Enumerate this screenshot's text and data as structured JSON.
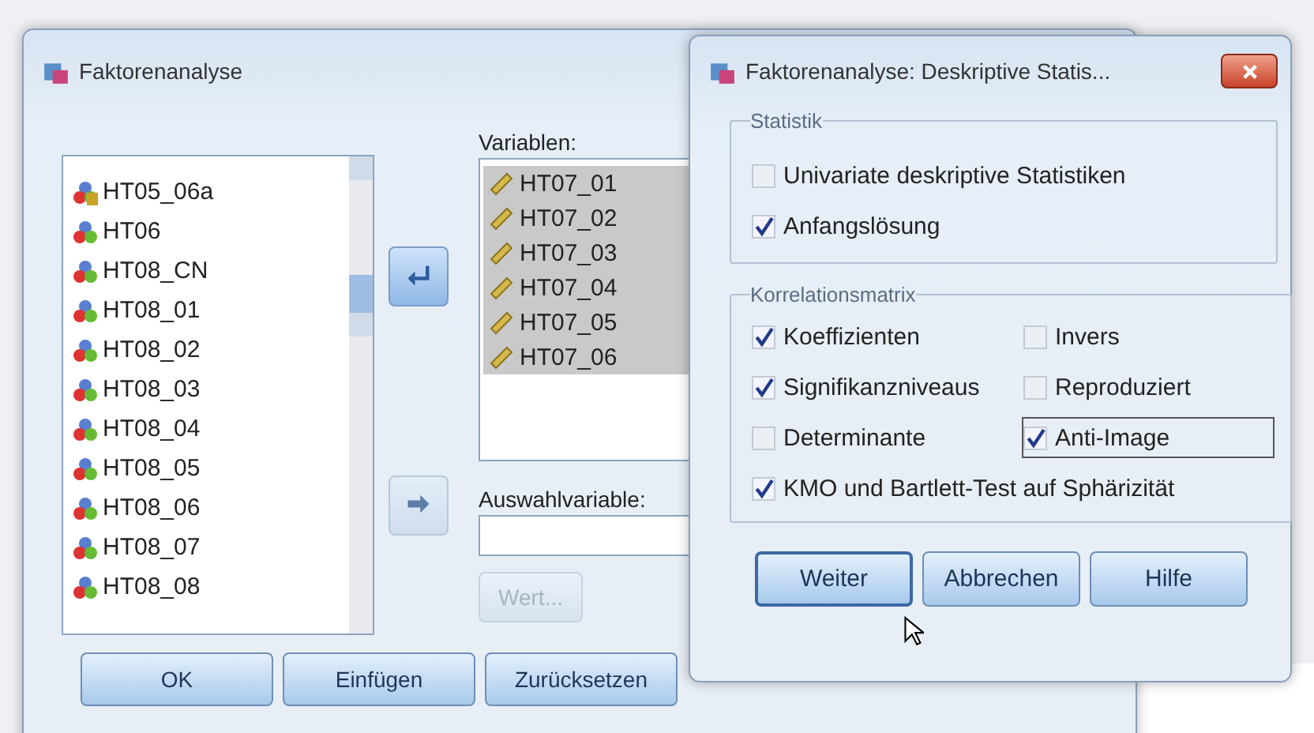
{
  "main_dialog": {
    "title": "Faktorenanalyse",
    "source_variables": [
      {
        "name": "HT05_06a",
        "kind": "string"
      },
      {
        "name": "HT06",
        "kind": "nominal"
      },
      {
        "name": "HT08_CN",
        "kind": "nominal"
      },
      {
        "name": "HT08_01",
        "kind": "nominal"
      },
      {
        "name": "HT08_02",
        "kind": "nominal"
      },
      {
        "name": "HT08_03",
        "kind": "nominal"
      },
      {
        "name": "HT08_04",
        "kind": "nominal"
      },
      {
        "name": "HT08_05",
        "kind": "nominal"
      },
      {
        "name": "HT08_06",
        "kind": "nominal"
      },
      {
        "name": "HT08_07",
        "kind": "nominal"
      },
      {
        "name": "HT08_08",
        "kind": "nominal"
      }
    ],
    "variables_label": "Variablen:",
    "variables": [
      {
        "name": "HT07_01",
        "kind": "scale",
        "selected": true
      },
      {
        "name": "HT07_02",
        "kind": "scale",
        "selected": true
      },
      {
        "name": "HT07_03",
        "kind": "scale",
        "selected": true
      },
      {
        "name": "HT07_04",
        "kind": "scale",
        "selected": true
      },
      {
        "name": "HT07_05",
        "kind": "scale",
        "selected": true
      },
      {
        "name": "HT07_06",
        "kind": "scale",
        "selected": true
      }
    ],
    "move_buttons": [
      {
        "disabled": false
      },
      {
        "disabled": true
      }
    ],
    "selection_label": "Auswahlvariable:",
    "value_button": {
      "label": "Wert...",
      "disabled": true
    },
    "buttons": [
      {
        "label": "OK"
      },
      {
        "label": "Einfügen"
      },
      {
        "label": "Zurücksetzen"
      }
    ]
  },
  "sub_dialog": {
    "title": "Faktorenanalyse: Deskriptive Statis...",
    "groups": [
      {
        "title": "Statistik",
        "items": [
          {
            "label": "Univariate deskriptive Statistiken",
            "checked": false,
            "focused": false
          },
          {
            "label": "Anfangslösung",
            "checked": true,
            "focused": false
          }
        ]
      },
      {
        "title": "Korrelationsmatrix",
        "items": [
          {
            "label": "Koeffizienten",
            "checked": true,
            "focused": false
          },
          {
            "label": "Invers",
            "checked": false,
            "focused": false
          },
          {
            "label": "Signifikanzniveaus",
            "checked": true,
            "focused": false
          },
          {
            "label": "Reproduziert",
            "checked": false,
            "focused": false
          },
          {
            "label": "Determinante",
            "checked": false,
            "focused": false
          },
          {
            "label": "Anti-Image",
            "checked": true,
            "focused": true
          },
          {
            "label": "KMO und Bartlett-Test auf Sphärizität",
            "checked": true,
            "focused": false
          }
        ]
      }
    ],
    "buttons": [
      {
        "label": "Weiter",
        "default": true
      },
      {
        "label": "Abbrechen",
        "default": false
      },
      {
        "label": "Hilfe",
        "default": false
      }
    ]
  }
}
